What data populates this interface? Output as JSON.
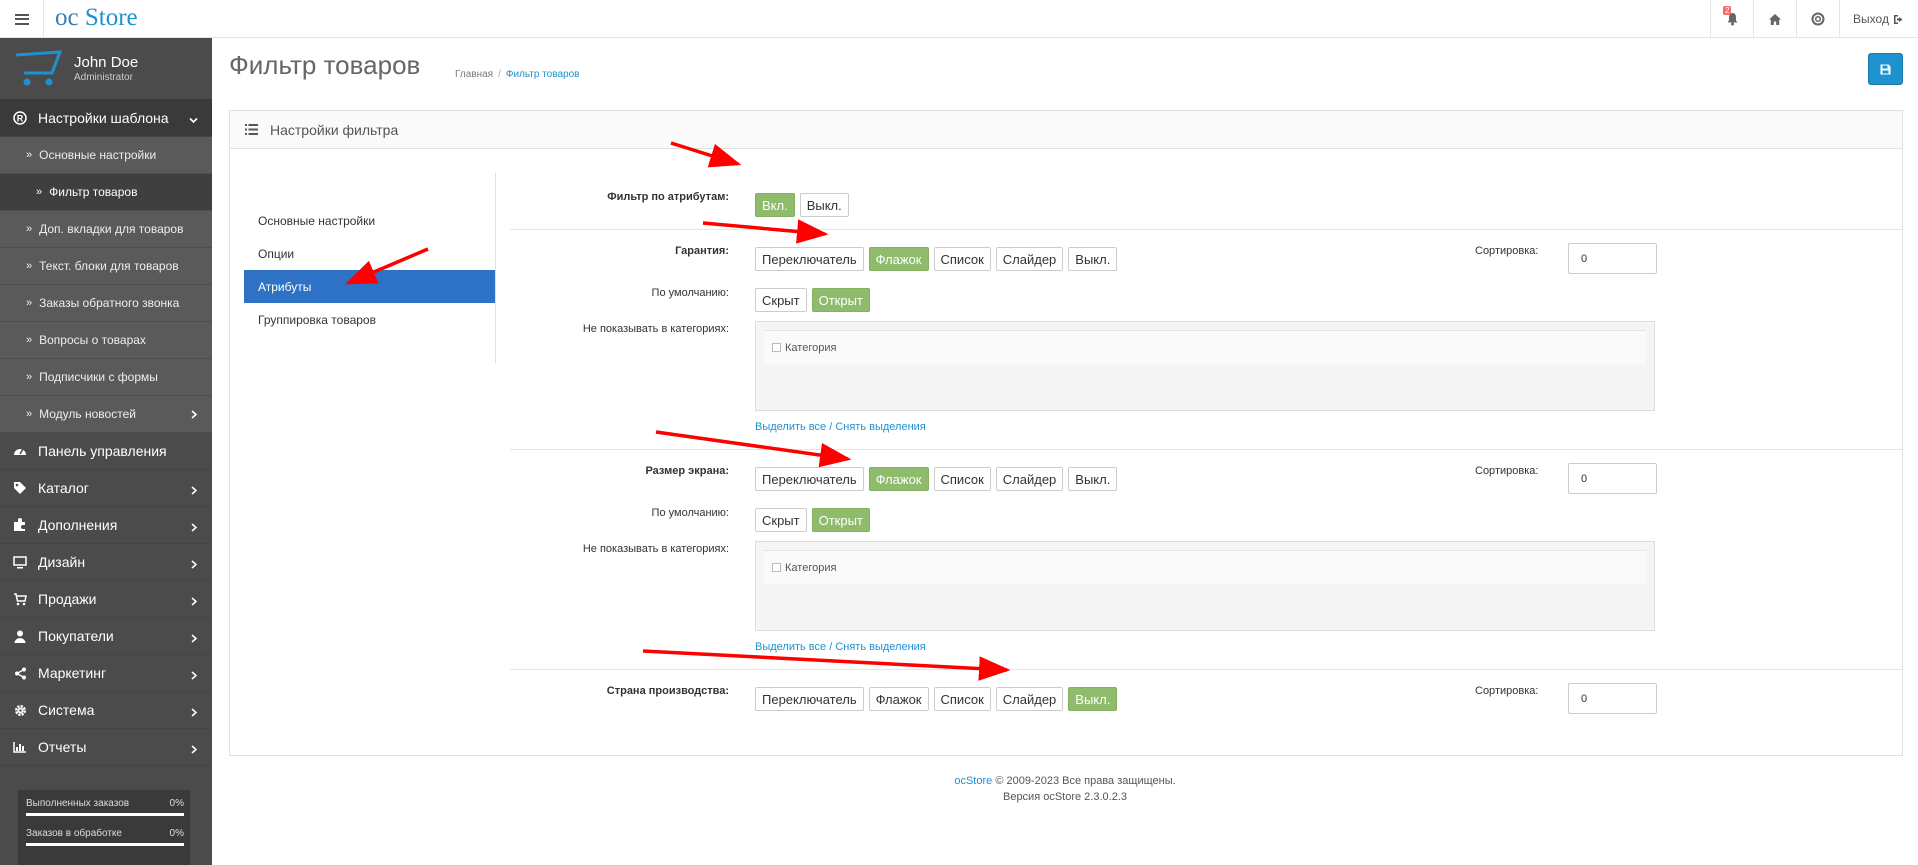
{
  "header": {
    "logo_oc": "oc",
    "logo_store": "Store",
    "notification_count": "2",
    "logout_label": "Выход"
  },
  "sidebar": {
    "user_name": "John Doe",
    "user_role": "Administrator",
    "section_open": "Настройки шаблона",
    "sub_items": [
      "Основные настройки",
      "Фильтр товаров",
      "Доп. вкладки для товаров",
      "Текст. блоки для товаров",
      "Заказы обратного звонка",
      "Вопросы о товарах",
      "Подписчики с формы",
      "Модуль новостей"
    ],
    "menu": [
      "Панель управления",
      "Каталог",
      "Дополнения",
      "Дизайн",
      "Продажи",
      "Покупатели",
      "Маркетинг",
      "Система",
      "Отчеты"
    ],
    "stats": [
      {
        "label": "Выполненных заказов",
        "value": "0%"
      },
      {
        "label": "Заказов в обработке",
        "value": "0%"
      }
    ]
  },
  "page": {
    "title": "Фильтр товаров",
    "breadcrumb_home": "Главная",
    "breadcrumb_sep": "/",
    "breadcrumb_current": "Фильтр товаров"
  },
  "panel": {
    "heading": "Настройки фильтра",
    "tabs": [
      "Основные настройки",
      "Опции",
      "Атрибуты",
      "Группировка товаров"
    ],
    "attr_filter_label": "Фильтр по атрибутам:",
    "attr_filter_on": "Вкл.",
    "attr_filter_off": "Выкл.",
    "view_options": [
      "Переключатель",
      "Флажок",
      "Список",
      "Слайдер",
      "Выкл."
    ],
    "default_label": "По умолчанию:",
    "default_options": [
      "Скрыт",
      "Открыт"
    ],
    "hide_in_categories_label": "Не показывать в категориях:",
    "category_header": "Категория",
    "select_all": "Выделить все",
    "links_sep": "/",
    "deselect_all": "Снять выделения",
    "sort_label": "Сортировка:",
    "attributes": [
      {
        "name": "Гарантия:",
        "selected": "Флажок",
        "default": "Открыт",
        "sort": "0"
      },
      {
        "name": "Размер экрана:",
        "selected": "Флажок",
        "default": "Открыт",
        "sort": "0"
      },
      {
        "name": "Страна производства:",
        "selected": "Выкл.",
        "sort": "0"
      }
    ]
  },
  "footer": {
    "brand": "ocStore",
    "copyright": "© 2009-2023 Все права защищены.",
    "version": "Версия ocStore 2.3.0.2.3"
  },
  "colors": {
    "sidebar_bg": "#4b4b4b",
    "accent_blue": "#1e91cf",
    "tab_active": "#2d72c4",
    "toggle_on": "#8fbb6c",
    "annotation_arrow": "#ff0000"
  }
}
